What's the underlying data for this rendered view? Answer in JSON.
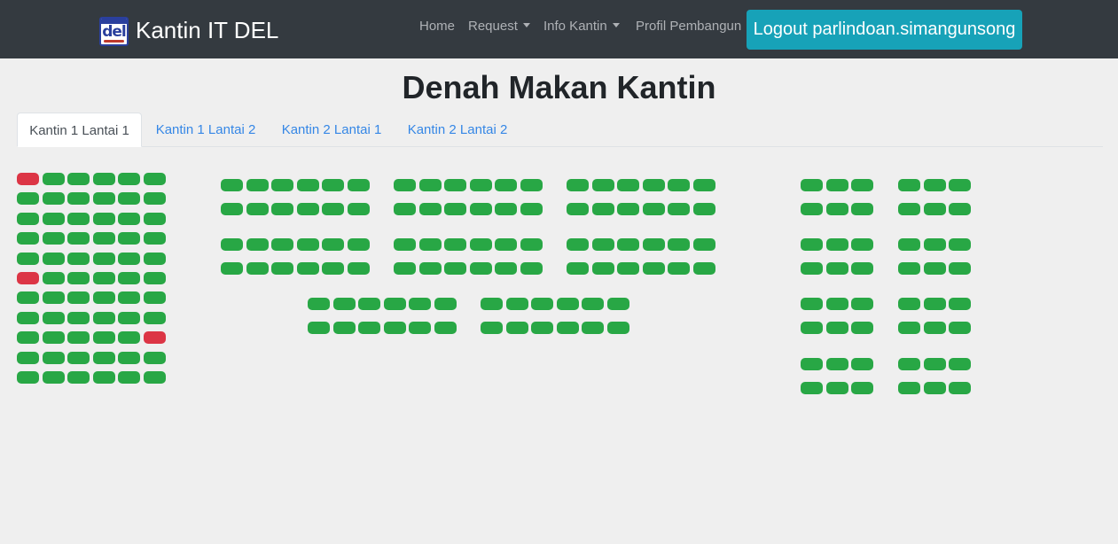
{
  "navbar": {
    "brand": {
      "logo_text": "del",
      "name": "Kantin IT DEL"
    },
    "links": [
      {
        "label": "Home",
        "dropdown": false
      },
      {
        "label": "Request",
        "dropdown": true
      },
      {
        "label": "Info Kantin",
        "dropdown": true
      },
      {
        "label": "Profil Pembangun",
        "dropdown": false
      }
    ],
    "logout_label": "Logout parlindoan.simangunsong"
  },
  "page": {
    "title": "Denah Makan Kantin"
  },
  "tabs": [
    {
      "label": "Kantin 1 Lantai 1",
      "active": true
    },
    {
      "label": "Kantin 1 Lantai 2",
      "active": false
    },
    {
      "label": "Kantin 2 Lantai 1",
      "active": false
    },
    {
      "label": "Kantin 2 Lantai 2",
      "active": false
    }
  ],
  "colors": {
    "navbar_bg": "#343a40",
    "logout_button": "#17a2b8",
    "seat_available": "#28a745",
    "seat_occupied": "#dc3545",
    "tab_link": "#3587e6",
    "page_bg": "#efefef"
  },
  "seat_map": {
    "groups": [
      {
        "name": "left-block",
        "rows": 11,
        "cols": 6,
        "occupied": [
          [
            0,
            0
          ],
          [
            5,
            0
          ],
          [
            8,
            5
          ]
        ]
      },
      {
        "name": "table-1",
        "rows": 2,
        "cols": 6,
        "occupied": []
      },
      {
        "name": "table-2",
        "rows": 2,
        "cols": 6,
        "occupied": []
      },
      {
        "name": "table-3",
        "rows": 2,
        "cols": 6,
        "occupied": []
      },
      {
        "name": "table-4",
        "rows": 2,
        "cols": 6,
        "occupied": []
      },
      {
        "name": "table-5",
        "rows": 2,
        "cols": 6,
        "occupied": []
      },
      {
        "name": "table-6",
        "rows": 2,
        "cols": 6,
        "occupied": []
      },
      {
        "name": "table-7",
        "rows": 2,
        "cols": 6,
        "occupied": []
      },
      {
        "name": "table-8",
        "rows": 2,
        "cols": 6,
        "occupied": []
      },
      {
        "name": "right-table-1",
        "rows": 2,
        "cols": 3,
        "occupied": []
      },
      {
        "name": "right-table-2",
        "rows": 2,
        "cols": 3,
        "occupied": []
      },
      {
        "name": "right-table-3",
        "rows": 2,
        "cols": 3,
        "occupied": []
      },
      {
        "name": "right-table-4",
        "rows": 2,
        "cols": 3,
        "occupied": []
      },
      {
        "name": "right-table-5",
        "rows": 2,
        "cols": 3,
        "occupied": []
      },
      {
        "name": "right-table-6",
        "rows": 2,
        "cols": 3,
        "occupied": []
      },
      {
        "name": "right-table-7",
        "rows": 2,
        "cols": 3,
        "occupied": []
      },
      {
        "name": "right-table-8",
        "rows": 2,
        "cols": 3,
        "occupied": []
      }
    ]
  }
}
